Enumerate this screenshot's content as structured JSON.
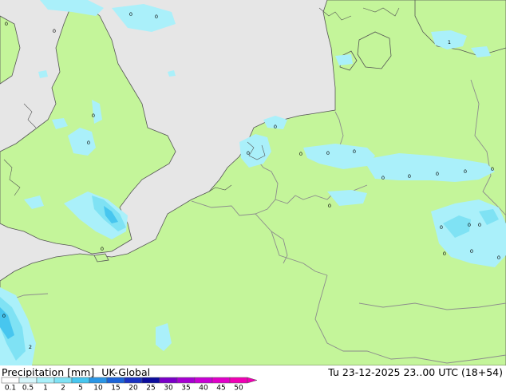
{
  "footer": {
    "title": "Precipitation [mm]",
    "model": "UK-Global",
    "datetime": "Tu 23-12-2025 23..00 UTC (18+54)"
  },
  "colors": {
    "sea": "#e6e6e6",
    "land": "#c4f59a",
    "border": "#8c8c8c",
    "coast": "#555555",
    "precip_light": "#aaf0fa"
  },
  "legend": {
    "labels": [
      "0.1",
      "0.5",
      "1",
      "2",
      "5",
      "10",
      "15",
      "20",
      "25",
      "30",
      "35",
      "40",
      "45",
      "50"
    ],
    "colors": [
      "#fefefe",
      "#d6f6fb",
      "#aaf0fa",
      "#7fe2f4",
      "#47c6ef",
      "#2a96e6",
      "#1c64d8",
      "#1a32c2",
      "#0c0c9c",
      "#7a00c8",
      "#a600d2",
      "#c800d4",
      "#e000c8",
      "#f000b4"
    ]
  },
  "markers": [
    {
      "label": "0"
    },
    {
      "label": "0"
    },
    {
      "label": "0"
    },
    {
      "label": "0"
    },
    {
      "label": "0"
    },
    {
      "label": "0"
    },
    {
      "label": "0"
    },
    {
      "label": "0"
    },
    {
      "label": "0"
    },
    {
      "label": "0"
    },
    {
      "label": "0"
    },
    {
      "label": "0"
    },
    {
      "label": "0"
    },
    {
      "label": "0"
    },
    {
      "label": "0"
    },
    {
      "label": "0"
    },
    {
      "label": "0"
    },
    {
      "label": "0"
    },
    {
      "label": "0"
    },
    {
      "label": "0"
    },
    {
      "label": "0"
    },
    {
      "label": "0"
    },
    {
      "label": "1"
    },
    {
      "label": "0"
    },
    {
      "label": "2"
    },
    {
      "label": "0"
    },
    {
      "label": "0"
    }
  ]
}
